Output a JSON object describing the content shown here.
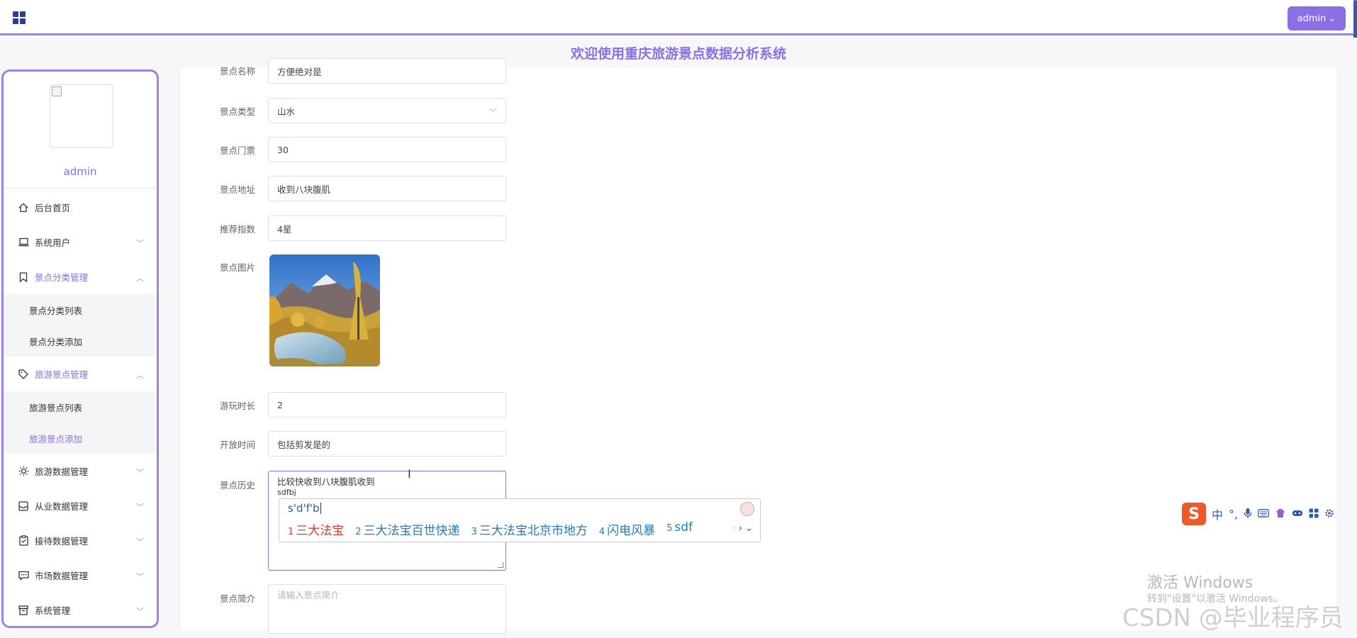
{
  "header": {
    "admin_label": "admin",
    "system_title": "欢迎使用重庆旅游景点数据分析系统"
  },
  "sidebar": {
    "username": "admin",
    "items": [
      {
        "label": "后台首页"
      },
      {
        "label": "系统用户"
      },
      {
        "label": "景点分类管理",
        "sub": [
          "景点分类列表",
          "景点分类添加"
        ]
      },
      {
        "label": "旅游景点管理",
        "sub": [
          "旅游景点列表",
          "旅游景点添加"
        ]
      },
      {
        "label": "旅游数据管理"
      },
      {
        "label": "从业数据管理"
      },
      {
        "label": "接待数据管理"
      },
      {
        "label": "市场数据管理"
      },
      {
        "label": "系统管理"
      }
    ]
  },
  "form": {
    "name": {
      "label": "景点名称",
      "value": "方便绝对是"
    },
    "type": {
      "label": "景点类型",
      "value": "山水"
    },
    "ticket": {
      "label": "景点门票",
      "value": "30"
    },
    "address": {
      "label": "景点地址",
      "value": "收到八块腹肌"
    },
    "rating": {
      "label": "推荐指数",
      "value": "4星"
    },
    "image": {
      "label": "景点图片"
    },
    "duration": {
      "label": "游玩时长",
      "value": "2"
    },
    "open_time": {
      "label": "开放时间",
      "value": "包括剪发是的"
    },
    "history": {
      "label": "景点历史",
      "line1": "比较快收到八块腹肌收到",
      "line2": "sdfbj"
    },
    "intro": {
      "label": "景点简介",
      "placeholder": "请输入景点简介"
    }
  },
  "ime": {
    "composition": "s'd'f'b",
    "candidates": [
      {
        "n": "1",
        "text": "三大法宝"
      },
      {
        "n": "2",
        "text": "三大法宝百世快递"
      },
      {
        "n": "3",
        "text": "三大法宝北京市地方"
      },
      {
        "n": "4",
        "text": "闪电风暴"
      },
      {
        "n": "5",
        "text": "sdf"
      }
    ],
    "toolbar": {
      "logo": "S",
      "lang": "中",
      "punct": "°,"
    }
  },
  "watermark": {
    "activate": "激活 Windows",
    "activate_hint": "转到\"设置\"以激活 Windows。",
    "csdn": "CSDN @毕业程序员"
  },
  "colors": {
    "accent": "#8b6fe6",
    "menu_icon": "#333333"
  }
}
